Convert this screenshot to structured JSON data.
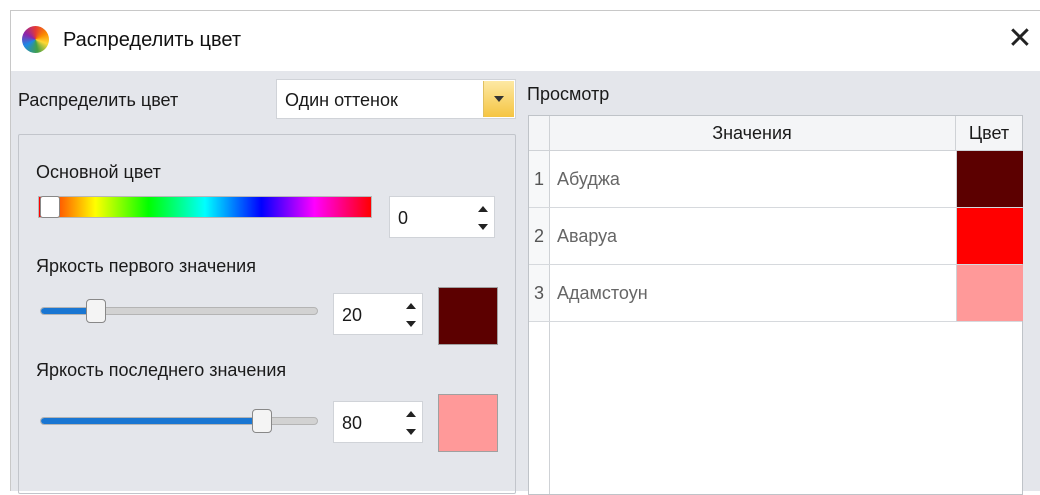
{
  "window": {
    "title": "Распределить цвет",
    "close_glyph": "✕"
  },
  "distribute": {
    "label": "Распределить цвет",
    "mode_value": "Один оттенок"
  },
  "base_color": {
    "label": "Основной цвет",
    "hue_value": "0"
  },
  "first_brightness": {
    "label": "Яркость первого значения",
    "value": "20",
    "slider_fraction": 0.2,
    "swatch_color": "#5c0000"
  },
  "last_brightness": {
    "label": "Яркость последнего значения",
    "value": "80",
    "slider_fraction": 0.8,
    "swatch_color": "#ff9999"
  },
  "preview": {
    "label": "Просмотр",
    "columns": {
      "values": "Значения",
      "color": "Цвет"
    },
    "rows": [
      {
        "num": "1",
        "value": "Абуджа",
        "color": "#5c0000"
      },
      {
        "num": "2",
        "value": "Аваруа",
        "color": "#ff0000"
      },
      {
        "num": "3",
        "value": "Адамстоун",
        "color": "#ff9999"
      }
    ]
  },
  "icons": {
    "app": "color-wheel-icon",
    "close": "close-icon",
    "dropdown": "chevron-down-icon",
    "spin": "spin-arrows-icon"
  }
}
